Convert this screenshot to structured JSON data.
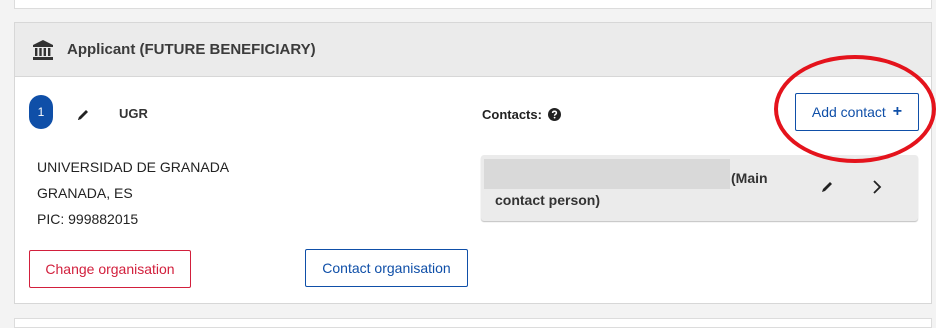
{
  "section": {
    "title": "Applicant (FUTURE BENEFICIARY)",
    "icon": "bank-building-icon"
  },
  "organisation": {
    "number": "1",
    "acronym": "UGR",
    "name": "UNIVERSIDAD DE GRANADA",
    "location": "GRANADA, ES",
    "pic": "PIC: 999882015",
    "edit_icon": "pencil-icon"
  },
  "actions": {
    "change_organisation": "Change organisation",
    "contact_organisation": "Contact organisation"
  },
  "contacts": {
    "label": "Contacts:",
    "help_icon": "question-circle-icon",
    "add_contact": "Add contact",
    "add_icon_glyph": "+",
    "items": [
      {
        "role": "(Main contact person)",
        "edit_icon": "pencil-icon",
        "open_icon": "chevron-right-icon"
      }
    ]
  },
  "colors": {
    "primary": "#0f4fa8",
    "danger": "#d21f3c",
    "annotation_ring": "#e4131c",
    "header_bg": "#ebebeb"
  }
}
